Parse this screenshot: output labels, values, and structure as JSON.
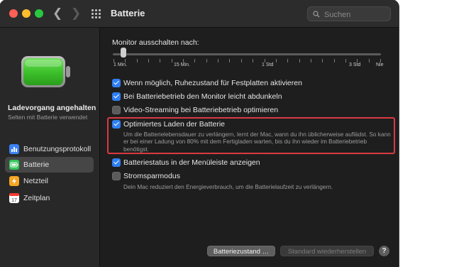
{
  "window": {
    "title": "Batterie"
  },
  "search": {
    "placeholder": "Suchen"
  },
  "sidebar": {
    "status_title": "Ladevorgang angehalten",
    "status_subtitle": "Selten mit Batterie verwendet",
    "items": [
      {
        "label": "Benutzungsprotokoll",
        "icon": "bar-chart-icon",
        "color": "#3b82f6"
      },
      {
        "label": "Batterie",
        "icon": "battery-icon",
        "color": "#34c759",
        "selected": true
      },
      {
        "label": "Netzteil",
        "icon": "power-plug-icon",
        "color": "#f5a623"
      },
      {
        "label": "Zeitplan",
        "icon": "calendar-icon",
        "color": "#ffffff"
      }
    ]
  },
  "monitor": {
    "label": "Monitor ausschalten nach:",
    "ticks": [
      "1 Min.",
      "15 Min.",
      "1 Std",
      "3 Std",
      "Nie"
    ],
    "value": "2 Min."
  },
  "options": [
    {
      "label": "Wenn möglich, Ruhezustand für Festplatten aktivieren",
      "checked": true
    },
    {
      "label": "Bei Batteriebetrieb den Monitor leicht abdunkeln",
      "checked": true
    },
    {
      "label": "Video-Streaming bei Batteriebetrieb optimieren",
      "checked": false
    },
    {
      "label": "Optimiertes Laden der Batterie",
      "checked": true,
      "description": "Um die Batterielebensdauer zu verlängern, lernt der Mac, wann du ihn üblicherweise auflädst. So kann er bei einer Ladung von 80% mit dem Fertigladen warten, bis du ihn wieder im Batteriebetrieb benötigst."
    },
    {
      "label": "Batteriestatus in der Menüleiste anzeigen",
      "checked": true
    },
    {
      "label": "Stromsparmodus",
      "checked": false,
      "description": "Dein Mac reduziert den Energieverbrauch, um die Batterielaufzeit zu verlängern."
    }
  ],
  "buttons": {
    "battery_health": "Batteriezustand …",
    "restore_defaults": "Standard wiederherstellen",
    "help": "?"
  },
  "colors": {
    "accent": "#2f7ff5",
    "highlight_box": "#d93a42",
    "battery_fill": "#4cd137"
  }
}
